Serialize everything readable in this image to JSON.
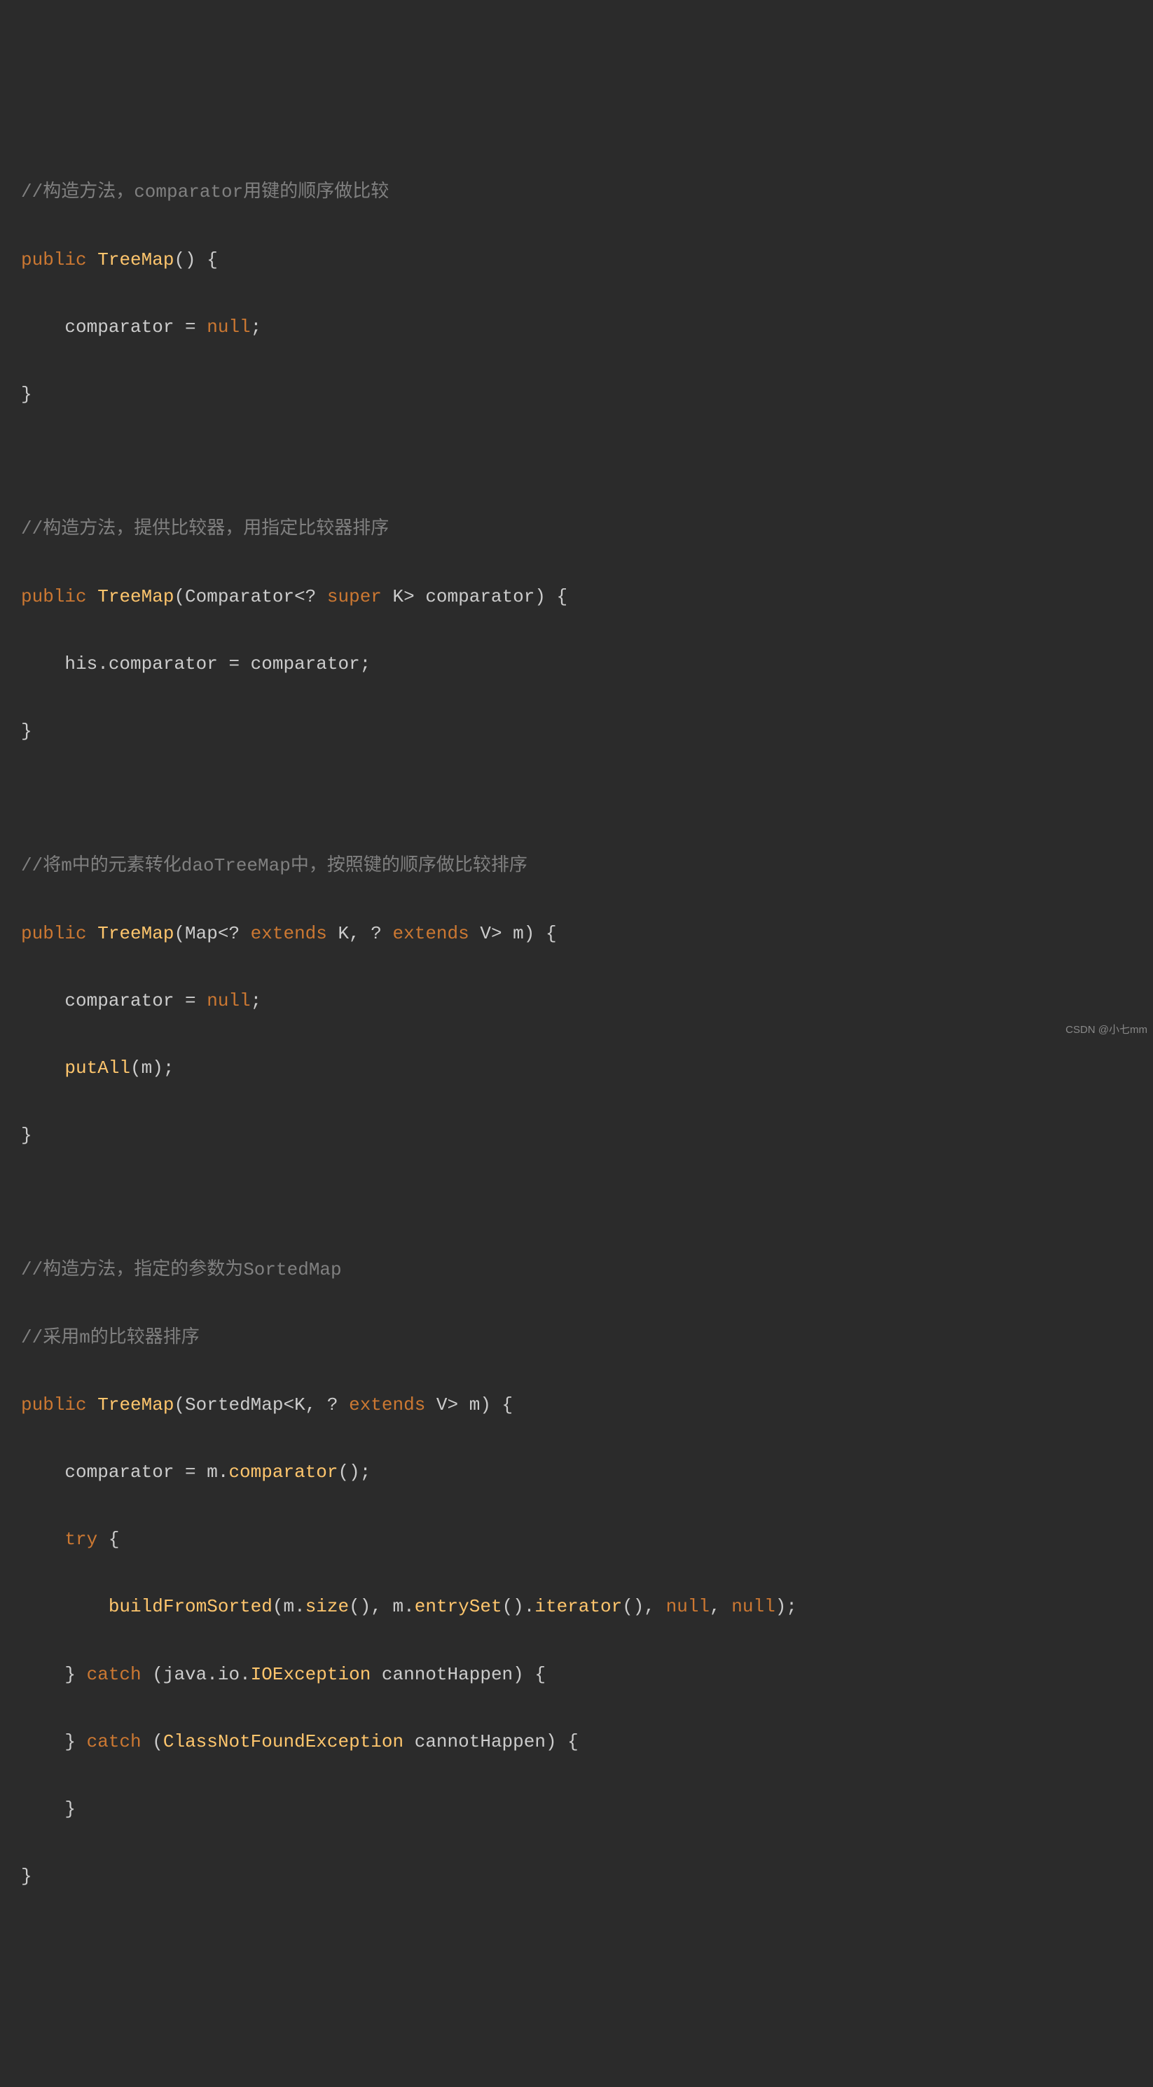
{
  "code": {
    "line1_comment": "//构造方法，comparator用键的顺序做比较",
    "line2_public": "public",
    "line2_method": "TreeMap",
    "line2_params": "() {",
    "line3_body": "    comparator = ",
    "line3_null": "null",
    "line3_end": ";",
    "line4_close": "}",
    "line6_comment": "//构造方法，提供比较器，用指定比较器排序",
    "line7_public": "public",
    "line7_method": "TreeMap",
    "line7_open": "(Comparator<? ",
    "line7_super": "super",
    "line7_rest": " K> comparator) {",
    "line8_body": "    his.comparator = comparator;",
    "line9_close": "}",
    "line11_comment": "//将m中的元素转化daoTreeMap中，按照键的顺序做比较排序",
    "line12_public": "public",
    "line12_method": "TreeMap",
    "line12_open": "(Map<? ",
    "line12_extends1": "extends",
    "line12_mid": " K, ? ",
    "line12_extends2": "extends",
    "line12_rest": " V> m) {",
    "line13_body": "    comparator = ",
    "line13_null": "null",
    "line13_end": ";",
    "line14_indent": "    ",
    "line14_call": "putAll",
    "line14_args": "(m);",
    "line15_close": "}",
    "line17_comment": "//构造方法，指定的参数为SortedMap",
    "line18_comment": "//采用m的比较器排序",
    "line19_public": "public",
    "line19_method": "TreeMap",
    "line19_open": "(SortedMap<K, ? ",
    "line19_extends": "extends",
    "line19_rest": " V> m) {",
    "line20_body": "    comparator = m.",
    "line20_call": "comparator",
    "line20_end": "();",
    "line21_indent": "    ",
    "line21_try": "try",
    "line21_brace": " {",
    "line22_indent": "        ",
    "line22_call1": "buildFromSorted",
    "line22_mid1": "(m.",
    "line22_call2": "size",
    "line22_mid2": "(), m.",
    "line22_call3": "entrySet",
    "line22_mid3": "().",
    "line22_call4": "iterator",
    "line22_mid4": "(), ",
    "line22_null1": "null",
    "line22_comma": ", ",
    "line22_null2": "null",
    "line22_end": ");",
    "line23_indent": "    } ",
    "line23_catch": "catch",
    "line23_open": " (java.io.",
    "line23_type": "IOException",
    "line23_rest": " cannotHappen) {",
    "line24_indent": "    } ",
    "line24_catch": "catch",
    "line24_open": " (",
    "line24_type": "ClassNotFoundException",
    "line24_rest": " cannotHappen) {",
    "line25_close": "    }",
    "line26_close": "}"
  },
  "watermark": "CSDN @小七mm"
}
